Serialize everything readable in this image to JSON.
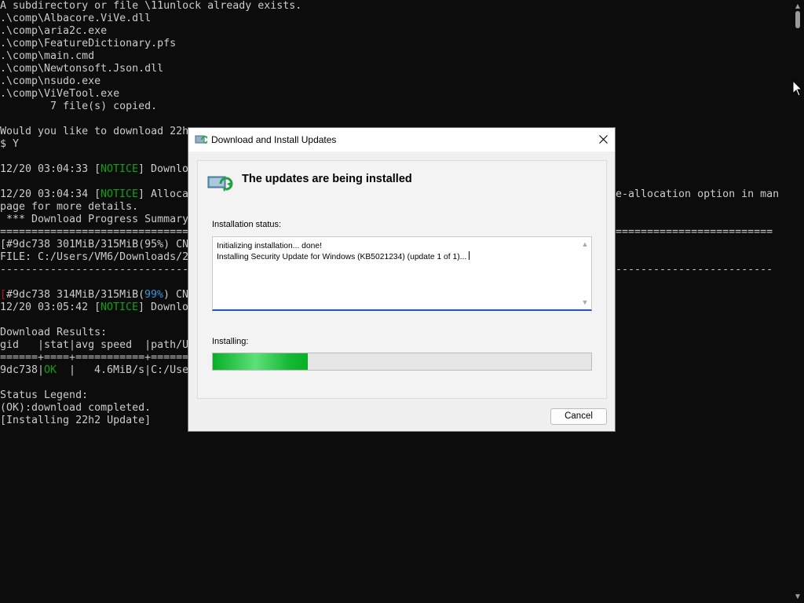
{
  "console": {
    "lines": [
      {
        "runs": [
          {
            "t": "A subdirectory or file \\11unlock already exists.",
            "c": ""
          }
        ]
      },
      {
        "runs": [
          {
            "t": ".\\comp\\Albacore.ViVe.dll",
            "c": ""
          }
        ]
      },
      {
        "runs": [
          {
            "t": ".\\comp\\aria2c.exe",
            "c": ""
          }
        ]
      },
      {
        "runs": [
          {
            "t": ".\\comp\\FeatureDictionary.pfs",
            "c": ""
          }
        ]
      },
      {
        "runs": [
          {
            "t": ".\\comp\\main.cmd",
            "c": ""
          }
        ]
      },
      {
        "runs": [
          {
            "t": ".\\comp\\Newtonsoft.Json.dll",
            "c": ""
          }
        ]
      },
      {
        "runs": [
          {
            "t": ".\\comp\\nsudo.exe",
            "c": ""
          }
        ]
      },
      {
        "runs": [
          {
            "t": ".\\comp\\ViVeTool.exe",
            "c": ""
          }
        ]
      },
      {
        "runs": [
          {
            "t": "        7 file(s) copied.",
            "c": ""
          }
        ]
      },
      {
        "runs": []
      },
      {
        "runs": [
          {
            "t": "Would you like to download 22h",
            "c": ""
          }
        ]
      },
      {
        "runs": [
          {
            "t": "$ Y",
            "c": ""
          }
        ]
      },
      {
        "runs": []
      },
      {
        "runs": [
          {
            "t": "12/20 03:04:33 [",
            "c": ""
          },
          {
            "t": "NOTICE",
            "c": "green"
          },
          {
            "t": "] Downlo",
            "c": ""
          }
        ]
      },
      {
        "runs": []
      },
      {
        "runs": [
          {
            "t": "12/20 03:04:34 [",
            "c": ""
          },
          {
            "t": "NOTICE",
            "c": "green"
          },
          {
            "t": "] Alloca",
            "c": ""
          },
          {
            "t": "e-allocation option in man",
            "c": "",
            "x": 98
          }
        ]
      },
      {
        "runs": [
          {
            "t": "page for more details.",
            "c": ""
          }
        ]
      },
      {
        "runs": [
          {
            "t": " *** Download Progress Summary",
            "c": ""
          }
        ]
      },
      {
        "runs": [
          {
            "t": "==============================",
            "c": ""
          },
          {
            "t": "=========================",
            "c": "",
            "x": 98
          }
        ]
      },
      {
        "runs": [
          {
            "t": "[#9dc738 301MiB/315MiB(95%) CN",
            "c": ""
          }
        ]
      },
      {
        "runs": [
          {
            "t": "FILE: C:/Users/VM6/Downloads/2",
            "c": ""
          }
        ]
      },
      {
        "runs": [
          {
            "t": "------------------------------",
            "c": ""
          },
          {
            "t": "-------------------------",
            "c": "",
            "x": 98
          }
        ]
      },
      {
        "runs": []
      },
      {
        "runs": [
          {
            "t": "[",
            "c": "red"
          },
          {
            "t": "#9dc738 314MiB/315MiB(",
            "c": ""
          },
          {
            "t": "99%",
            "c": "cyan"
          },
          {
            "t": ") CN",
            "c": ""
          }
        ]
      },
      {
        "runs": [
          {
            "t": "12/20 03:05:42 [",
            "c": ""
          },
          {
            "t": "NOTICE",
            "c": "green"
          },
          {
            "t": "] Downlo",
            "c": ""
          }
        ]
      },
      {
        "runs": []
      },
      {
        "runs": [
          {
            "t": "Download Results:",
            "c": ""
          }
        ]
      },
      {
        "runs": [
          {
            "t": "gid   |stat|avg speed  |path/U",
            "c": ""
          }
        ]
      },
      {
        "runs": [
          {
            "t": "======+====+===========+======",
            "c": ""
          }
        ]
      },
      {
        "runs": [
          {
            "t": "9dc738|",
            "c": ""
          },
          {
            "t": "OK",
            "c": "green"
          },
          {
            "t": "  |   4.6MiB/s|C:/Use",
            "c": ""
          }
        ]
      },
      {
        "runs": []
      },
      {
        "runs": [
          {
            "t": "Status Legend:",
            "c": ""
          }
        ]
      },
      {
        "runs": [
          {
            "t": "(OK):download completed.",
            "c": ""
          }
        ]
      },
      {
        "runs": [
          {
            "t": "[Installing 22h2 Update]",
            "c": ""
          }
        ]
      }
    ]
  },
  "dialog": {
    "title": "Download and Install Updates",
    "heading": "The updates are being installed",
    "status_label": "Installation status:",
    "log_lines": [
      "Initializing installation... done!",
      "Installing Security Update for Windows (KB5021234) (update 1 of 1)..."
    ],
    "installing_label": "Installing:",
    "progress_fraction": 0.25,
    "cancel_label": "Cancel"
  },
  "icons": {
    "title": "windows-update-icon",
    "header": "windows-update-large-icon",
    "close": "close-icon",
    "cursor": "mouse-pointer-icon"
  },
  "colors": {
    "console_bg": "#0c0c0c",
    "console_text": "#cccccc",
    "notice_green": "#13a10e",
    "percent_cyan": "#3a96dd",
    "bracket_red": "#c50f1f",
    "progress_green": "#06b025",
    "focus_blue": "#1e5aa6"
  }
}
